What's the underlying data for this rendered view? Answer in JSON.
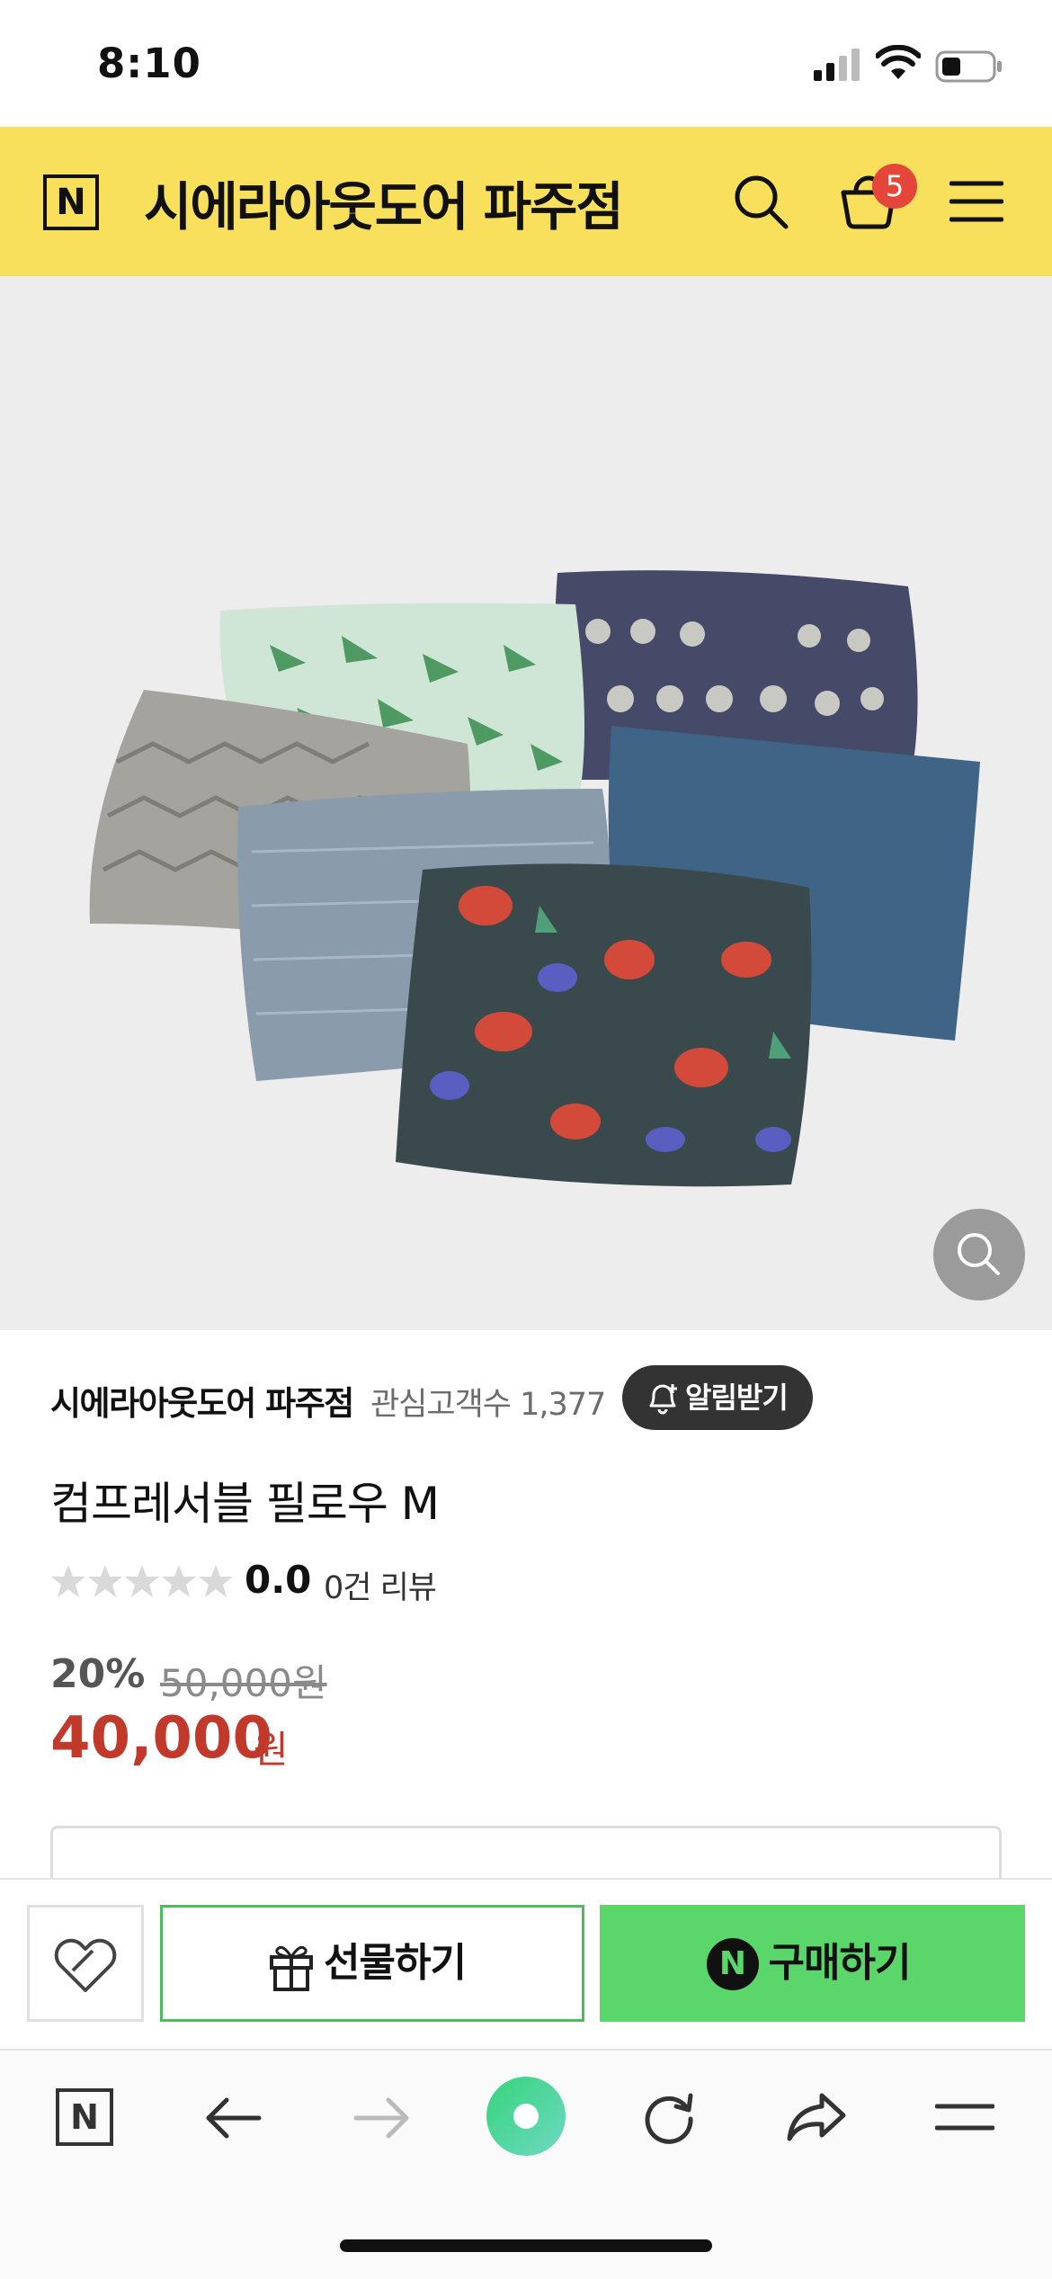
{
  "status_bar": {
    "time": "8:10"
  },
  "header": {
    "logo": "N",
    "store_title": "시에라아웃도어 파주점",
    "cart_count": "5"
  },
  "store_info": {
    "name": "시에라아웃도어 파주점",
    "interest_label": "관심고객수 1,377",
    "notify_label": "알림받기"
  },
  "product": {
    "name": "컴프레서블 필로우 M",
    "rating": "0.0",
    "review_count": "0건 리뷰",
    "stars_filled": 0,
    "stars_total": 5,
    "discount_rate": "20%",
    "original_price": "50,000원",
    "sale_price": "40,000",
    "sale_unit": "원"
  },
  "purchase_bar": {
    "gift_label": "선물하기",
    "buy_label": "구매하기",
    "naverpay_logo": "N"
  },
  "toolbar": {
    "home_logo": "N"
  },
  "colors": {
    "header_bg": "#f9e05c",
    "badge": "#e5463a",
    "sale_price": "#c0392b",
    "buy_button": "#5bd66b",
    "gift_border": "#4dbd5b"
  },
  "icons": [
    "search-icon",
    "cart-icon",
    "menu-icon",
    "zoom-icon",
    "bell-icon",
    "heart-icon",
    "gift-icon",
    "back-arrow-icon",
    "forward-arrow-icon",
    "green-dot-icon",
    "refresh-icon",
    "share-icon"
  ]
}
